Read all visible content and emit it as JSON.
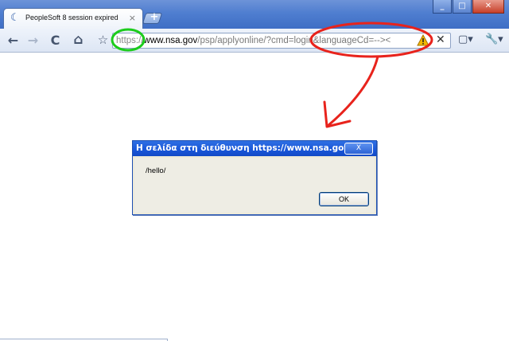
{
  "browser": {
    "tab": {
      "title": "PeopleSoft 8 session expired",
      "close_glyph": "×"
    },
    "new_tab_glyph": "+",
    "window_controls": {
      "minimize": "_",
      "maximize": "□",
      "close": "✕"
    },
    "toolbar": {
      "back_icon": "←",
      "forward_icon": "→",
      "reload_icon": "C",
      "home_icon": "⌂",
      "bookmark_icon": "☆",
      "stop_icon": "✕",
      "page_menu_icon": "▢▾",
      "tools_menu_icon": "🔧▾"
    },
    "address_bar": {
      "scheme": "https://",
      "host": "www.nsa.gov",
      "path": "/psp/applyonline/?cmd=login&languageCd=-->< "
    }
  },
  "dialog": {
    "title": "Η σελίδα στη διεύθυνση https://www.nsa.gov...",
    "close_label": "X",
    "message": "/hello/",
    "ok_label": "OK"
  },
  "colors": {
    "annotation_red": "#e8231c",
    "annotation_green": "#1ccc1c",
    "dialog_title_blue": "#1856d8"
  }
}
